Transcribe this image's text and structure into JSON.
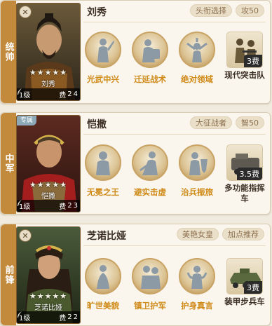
{
  "generals": [
    {
      "role": "统帅",
      "name": "刘秀",
      "portrait_name": "刘秀",
      "stars": "★★★★★",
      "level": "1级",
      "cost_label": "费",
      "cost_value": "2",
      "extra": "4",
      "badge": "✕",
      "tags": [
        "头衔选择",
        "攻50"
      ],
      "skills": [
        "光武中兴",
        "迁延战术",
        "绝对领域"
      ],
      "unit": {
        "name": "现代突击队",
        "cost": "3费"
      }
    },
    {
      "role": "中军",
      "name": "恺撒",
      "portrait_tag": "专属",
      "portrait_name": "恺撒",
      "stars": "★★★★★",
      "level": "1级",
      "cost_label": "费",
      "cost_value": "2",
      "extra": "3",
      "tags": [
        "大征战者",
        "智50"
      ],
      "skills": [
        "无冕之王",
        "避实击虚",
        "治兵振旅"
      ],
      "unit": {
        "name": "多功能指挥车",
        "cost": "3.5费"
      }
    },
    {
      "role": "前锋",
      "name": "芝诺比娅",
      "portrait_name": "芝诺比娅",
      "stars": "★★★★★",
      "level": "1级",
      "cost_label": "费",
      "cost_value": "2",
      "extra": "2",
      "badge": "✕",
      "tags": [
        "美艳女皇",
        "加点推荐"
      ],
      "skills": [
        "旷世美貌",
        "镇卫护军",
        "护身真言"
      ],
      "unit": {
        "name": "装甲步兵车",
        "cost": "3费"
      }
    }
  ],
  "colors": {
    "role_bg": "#c48a3c",
    "skill_label": "#d08a18",
    "tag_bg": "#eadfc9"
  }
}
